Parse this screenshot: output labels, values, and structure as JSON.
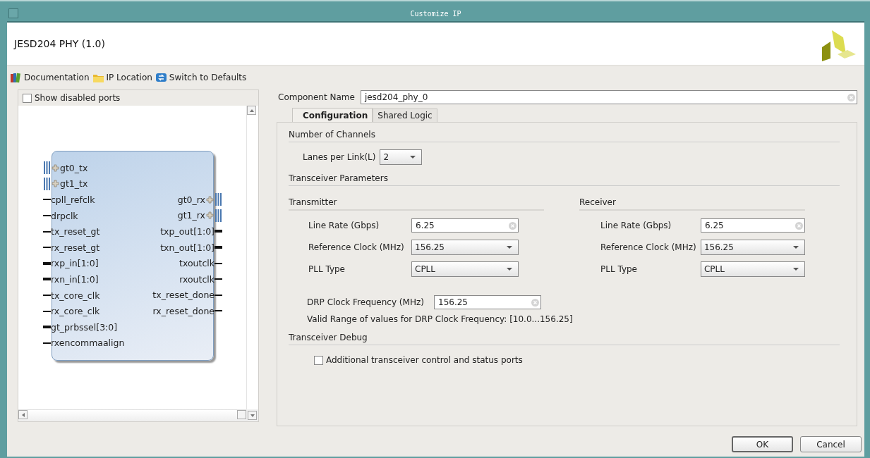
{
  "window": {
    "title": "Customize IP"
  },
  "header": {
    "title": "JESD204 PHY (1.0)"
  },
  "toolbar": [
    {
      "label": "Documentation"
    },
    {
      "label": "IP Location"
    },
    {
      "label": "Switch to Defaults"
    }
  ],
  "symbol_panel": {
    "show_disabled_ports": {
      "label": "Show disabled ports",
      "checked": false
    },
    "left_ports": [
      {
        "name": "gt0_tx",
        "kind": "bus"
      },
      {
        "name": "gt1_tx",
        "kind": "bus"
      },
      {
        "name": "cpll_refclk",
        "kind": "wire"
      },
      {
        "name": "drpclk",
        "kind": "wire"
      },
      {
        "name": "tx_reset_gt",
        "kind": "wire"
      },
      {
        "name": "rx_reset_gt",
        "kind": "wire"
      },
      {
        "name": "rxp_in[1:0]",
        "kind": "vector"
      },
      {
        "name": "rxn_in[1:0]",
        "kind": "vector"
      },
      {
        "name": "tx_core_clk",
        "kind": "wire"
      },
      {
        "name": "rx_core_clk",
        "kind": "wire"
      },
      {
        "name": "gt_prbssel[3:0]",
        "kind": "vector"
      },
      {
        "name": "rxencommaalign",
        "kind": "wire"
      }
    ],
    "right_ports": [
      {
        "name": "gt0_rx",
        "kind": "bus"
      },
      {
        "name": "gt1_rx",
        "kind": "bus"
      },
      {
        "name": "txp_out[1:0]",
        "kind": "vector"
      },
      {
        "name": "txn_out[1:0]",
        "kind": "vector"
      },
      {
        "name": "txoutclk",
        "kind": "wire"
      },
      {
        "name": "rxoutclk",
        "kind": "wire"
      },
      {
        "name": "tx_reset_done",
        "kind": "wire"
      },
      {
        "name": "rx_reset_done",
        "kind": "wire"
      }
    ]
  },
  "component_name": {
    "label": "Component Name",
    "value": "jesd204_phy_0"
  },
  "tabs": [
    {
      "label": "Configuration",
      "selected": true
    },
    {
      "label": "Shared Logic",
      "selected": false
    }
  ],
  "number_of_channels": {
    "title": "Number of Channels",
    "lanes_per_link": {
      "label": "Lanes per Link(L)",
      "value": "2"
    }
  },
  "transceiver_parameters": {
    "title": "Transceiver Parameters",
    "groups": [
      {
        "title": "Transmitter",
        "fields": [
          {
            "label": "Line Rate (Gbps)",
            "kind": "text",
            "value": "6.25"
          },
          {
            "label": "Reference Clock (MHz)",
            "kind": "select",
            "value": "156.25"
          },
          {
            "label": "PLL Type",
            "kind": "select",
            "value": "CPLL"
          }
        ]
      },
      {
        "title": "Receiver",
        "fields": [
          {
            "label": "Line Rate (Gbps)",
            "kind": "text",
            "value": "6.25"
          },
          {
            "label": "Reference Clock (MHz)",
            "kind": "select",
            "value": "156.25"
          },
          {
            "label": "PLL Type",
            "kind": "select",
            "value": "CPLL"
          }
        ]
      }
    ],
    "drp_clock": {
      "label": "DRP Clock Frequency (MHz)",
      "value": "156.25"
    },
    "valid_range": "Valid Range of values for DRP Clock Frequency: [10.0...156.25]"
  },
  "transceiver_debug": {
    "title": "Transceiver Debug",
    "additional_ports": {
      "label": "Additional transceiver control and status ports",
      "checked": false
    }
  },
  "buttons": [
    {
      "label": "OK",
      "default": true
    },
    {
      "label": "Cancel",
      "default": false
    }
  ]
}
